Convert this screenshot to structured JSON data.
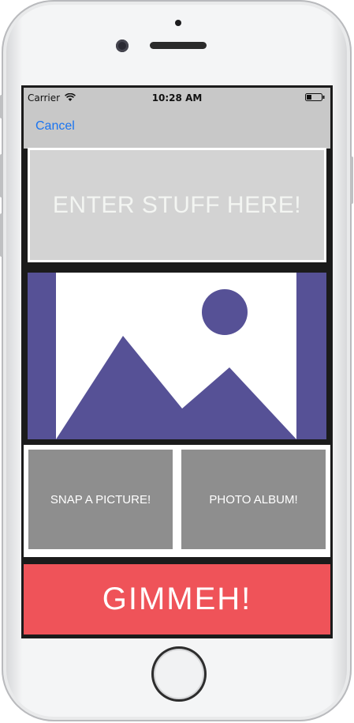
{
  "status_bar": {
    "carrier": "Carrier",
    "time": "10:28 AM",
    "wifi_icon": "wifi-icon",
    "battery_icon": "battery-icon"
  },
  "nav": {
    "cancel_label": "Cancel"
  },
  "input": {
    "placeholder": "ENTER STUFF HERE!"
  },
  "image_placeholder": {
    "icon": "image-placeholder-icon",
    "color": "#565196"
  },
  "actions": {
    "snap_label": "SNAP A PICTURE!",
    "album_label": "PHOTO ALBUM!",
    "gimmeh_label": "GIMMEH!"
  },
  "colors": {
    "accent": "#1a74f0",
    "primary_button": "#ef5359",
    "secondary_button": "#8e8e8e",
    "field_background": "#d3d3d3"
  }
}
